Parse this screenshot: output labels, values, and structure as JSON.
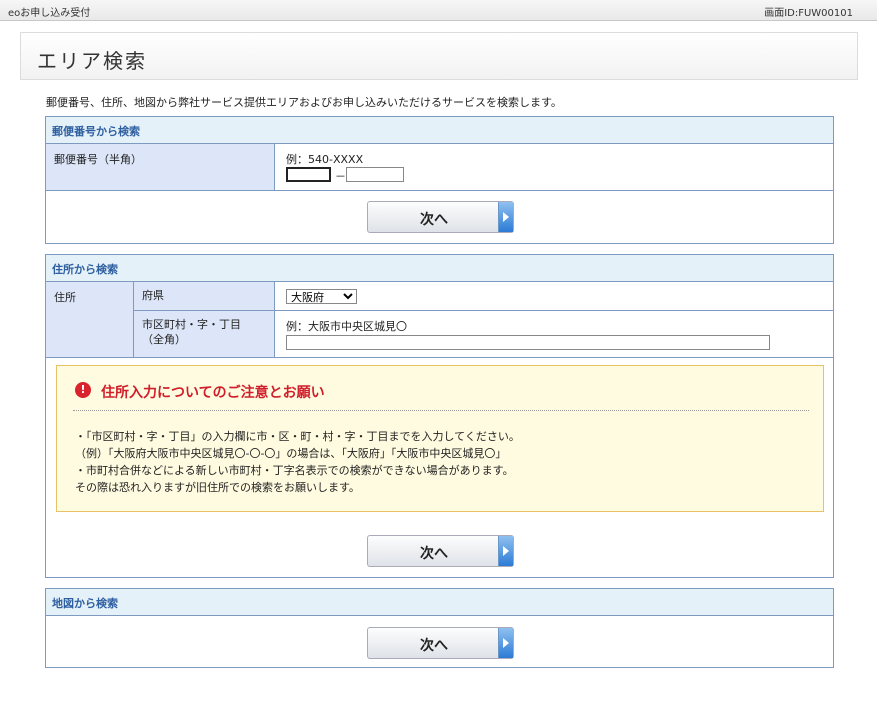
{
  "topbar": {
    "left": "eoお申し込み受付",
    "right": "画面ID:FUW00101"
  },
  "page_title": "エリア検索",
  "intro": "郵便番号、住所、地図から弊社サービス提供エリアおよびお申し込みいただけるサービスを検索します。",
  "postal": {
    "heading": "郵便番号から検索",
    "label": "郵便番号（半角）",
    "hint": "例：540-XXXX",
    "separator": "－",
    "first_value": "",
    "second_value": "",
    "next_label": "次へ"
  },
  "address": {
    "heading": "住所から検索",
    "group_label": "住所",
    "pref_label": "府県",
    "pref_value": "大阪府",
    "city_label": "市区町村・字・丁目\n（全角）",
    "city_hint": "例：大阪市中央区城見〇",
    "city_value": "",
    "notice_title": "住所入力についてのご注意とお願い",
    "notice_lines": [
      "・「市区町村・字・丁目」の入力欄に市・区・町・村・字・丁目までを入力してください。",
      "（例）「大阪府大阪市中央区城見〇-〇-〇」の場合は、「大阪府」「大阪市中央区城見〇」",
      "・市町村合併などによる新しい市町村・丁字名表示での検索ができない場合があります。",
      "その際は恐れ入りますが旧住所での検索をお願いします。"
    ],
    "next_label": "次へ"
  },
  "map": {
    "heading": "地図から検索",
    "next_label": "次へ"
  },
  "colors": {
    "section_border": "#7f9ac0",
    "label_bg": "#dde6f8",
    "heading_bg": "#e4f1f8",
    "heading_text": "#2e5fa0",
    "notice_title": "#d01e2a"
  }
}
